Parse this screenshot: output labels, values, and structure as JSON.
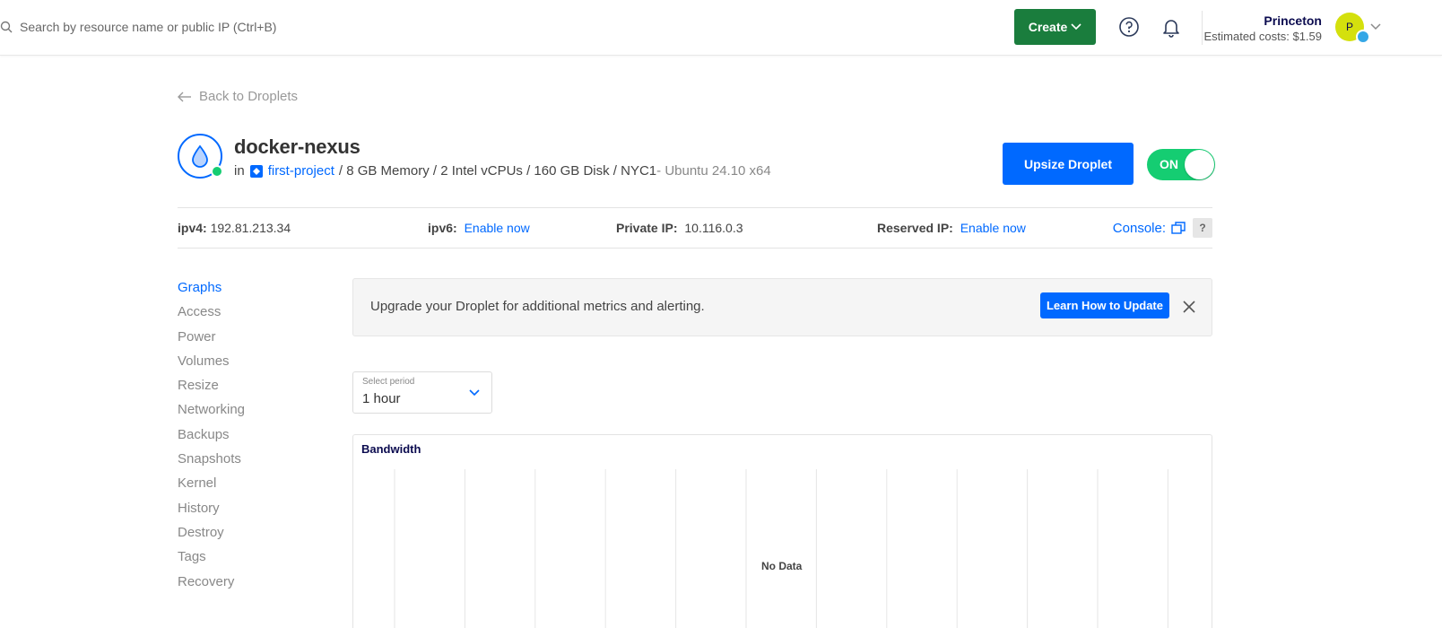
{
  "topbar": {
    "search_placeholder": "Search by resource name or public IP (Ctrl+B)",
    "create_label": "Create",
    "user_name": "Princeton",
    "estimated_costs": "Estimated costs: $1.59",
    "avatar_initial": "P"
  },
  "back_link": "Back to Droplets",
  "droplet": {
    "name": "docker-nexus",
    "in_label": "in",
    "project": "first-project",
    "specs": "/ 8 GB Memory / 2 Intel vCPUs / 160 GB Disk / NYC1",
    "os": " - Ubuntu 24.10 x64",
    "upsize_label": "Upsize Droplet",
    "power_label": "ON"
  },
  "ip_row": {
    "ipv4_label": "ipv4:",
    "ipv4_value": "192.81.213.34",
    "ipv6_label": "ipv6:",
    "ipv6_link": "Enable now",
    "private_label": "Private IP:",
    "private_value": "10.116.0.3",
    "reserved_label": "Reserved IP:",
    "reserved_link": "Enable now",
    "console_label": "Console:",
    "help_label": "?"
  },
  "side_nav": {
    "items": [
      "Graphs",
      "Access",
      "Power",
      "Volumes",
      "Resize",
      "Networking",
      "Backups",
      "Snapshots",
      "Kernel",
      "History",
      "Destroy",
      "Tags",
      "Recovery"
    ],
    "active": "Graphs"
  },
  "alert": {
    "text": "Upgrade your Droplet for additional metrics and alerting.",
    "button": "Learn How to Update"
  },
  "period": {
    "label": "Select period",
    "value": "1 hour"
  },
  "bandwidth": {
    "title": "Bandwidth",
    "empty_text": "No Data"
  },
  "colors": {
    "accent": "#0069ff",
    "create_green": "#1a7d3d",
    "power_green": "#15cd72",
    "avatar": "#d4e00d"
  }
}
